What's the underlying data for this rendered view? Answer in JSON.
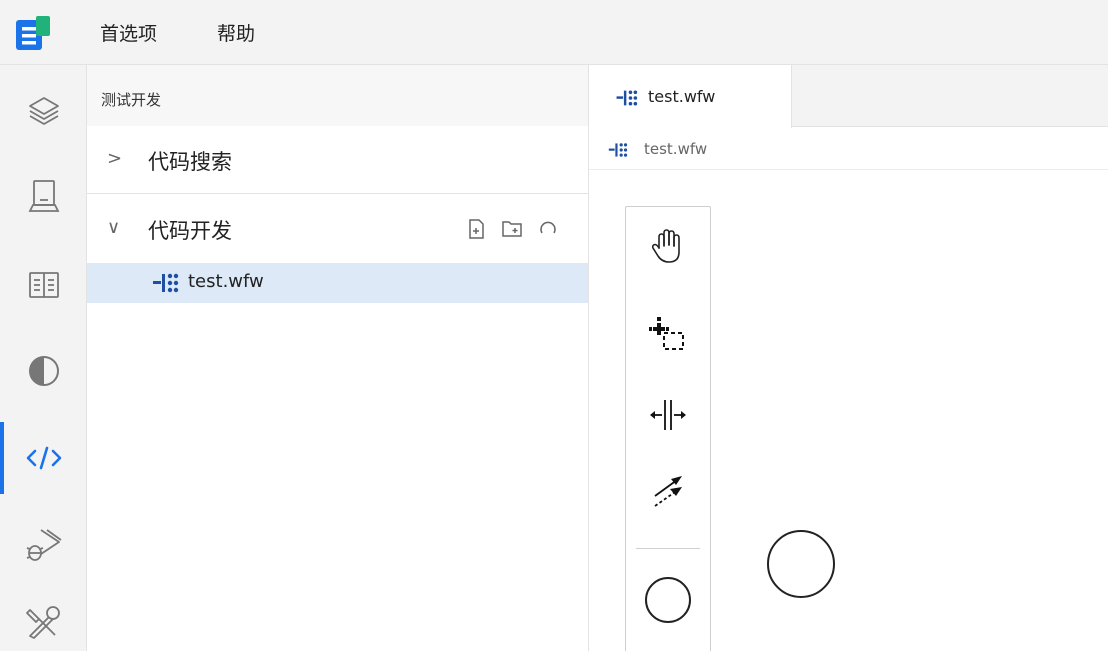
{
  "menubar": {
    "items": [
      {
        "label": "首选项"
      },
      {
        "label": "帮助"
      }
    ]
  },
  "colors": {
    "accent": "#1a73e8",
    "selected_row": "#dde9f7",
    "wfw_icon": "#1e4fa3"
  },
  "activitybar": {
    "icons": [
      "layers-icon",
      "computer-icon",
      "book-icon",
      "theme-icon",
      "code-icon",
      "debug-icon",
      "tools-icon"
    ],
    "active": "code-icon"
  },
  "explorer": {
    "title": "测试开发",
    "sections": [
      {
        "label": "代码搜索",
        "expanded": false,
        "chevron": ">"
      },
      {
        "label": "代码开发",
        "expanded": true,
        "chevron": "∨"
      }
    ],
    "actions": [
      "new-file-icon",
      "new-folder-icon",
      "refresh-icon"
    ],
    "files": [
      {
        "name": "test.wfw",
        "selected": true
      }
    ]
  },
  "editor": {
    "tabs": [
      {
        "label": "test.wfw",
        "active": true
      }
    ],
    "breadcrumb": {
      "label": "test.wfw"
    },
    "palette": [
      "hand-tool-icon",
      "lasso-tool-icon",
      "space-tool-icon",
      "global-connect-icon",
      "start-event-icon"
    ]
  }
}
